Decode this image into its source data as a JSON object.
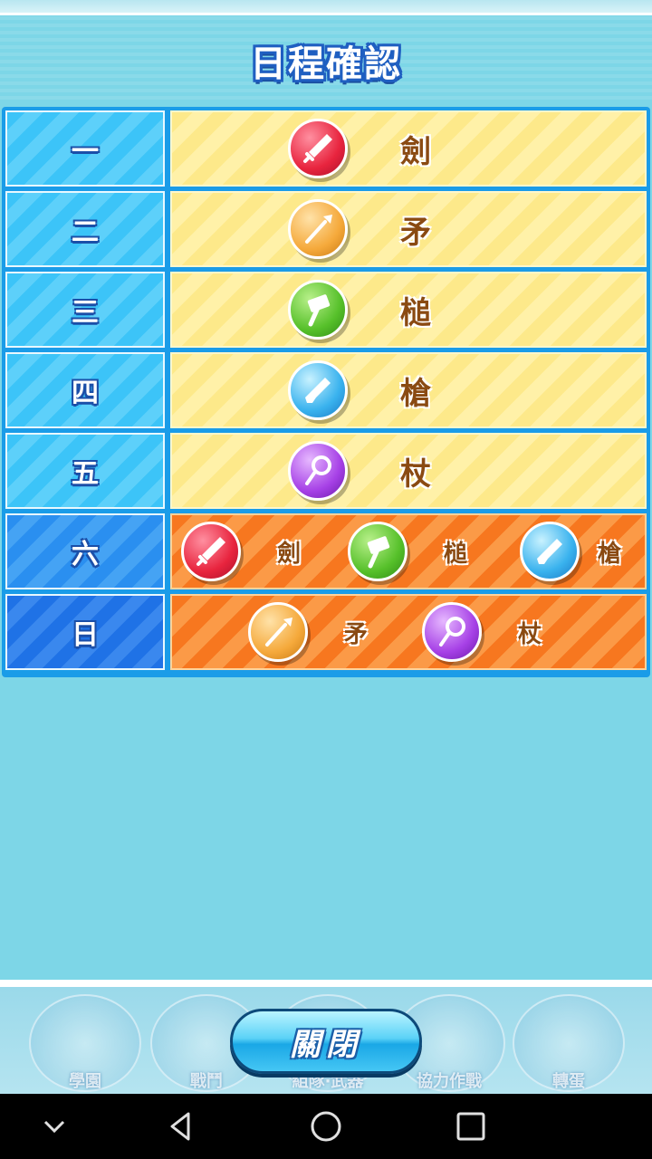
{
  "header": {
    "title": "日程確認"
  },
  "schedule": [
    {
      "day": "一",
      "type": "weekday",
      "weapons": [
        {
          "name": "劍",
          "icon": "sword-icon",
          "color": "#e8243e"
        }
      ]
    },
    {
      "day": "二",
      "type": "weekday",
      "weapons": [
        {
          "name": "矛",
          "icon": "spear-icon",
          "color": "#f5a93b"
        }
      ]
    },
    {
      "day": "三",
      "type": "weekday",
      "weapons": [
        {
          "name": "槌",
          "icon": "hammer-icon",
          "color": "#56c02a"
        }
      ]
    },
    {
      "day": "四",
      "type": "weekday",
      "weapons": [
        {
          "name": "槍",
          "icon": "gun-icon",
          "color": "#39b2ee"
        }
      ]
    },
    {
      "day": "五",
      "type": "weekday",
      "weapons": [
        {
          "name": "杖",
          "icon": "staff-icon",
          "color": "#a640e6"
        }
      ]
    },
    {
      "day": "六",
      "type": "weekend",
      "weapons": [
        {
          "name": "劍",
          "icon": "sword-icon",
          "color": "#e8243e"
        },
        {
          "name": "槌",
          "icon": "hammer-icon",
          "color": "#56c02a"
        },
        {
          "name": "槍",
          "icon": "gun-icon",
          "color": "#39b2ee"
        }
      ]
    },
    {
      "day": "日",
      "type": "sunday",
      "weapons": [
        {
          "name": "矛",
          "icon": "spear-icon",
          "color": "#f5a93b"
        },
        {
          "name": "杖",
          "icon": "staff-icon",
          "color": "#a640e6"
        }
      ]
    }
  ],
  "footer": {
    "close_label": "關閉",
    "nav_items": [
      {
        "label": "學園",
        "icon": "school-icon"
      },
      {
        "label": "戰鬥",
        "icon": "battle-icon"
      },
      {
        "label": "組隊·武器",
        "icon": "team-weapon-icon"
      },
      {
        "label": "協力作戰",
        "icon": "coop-icon"
      },
      {
        "label": "轉蛋",
        "icon": "gacha-icon"
      }
    ]
  },
  "system_nav": [
    "chevron-down-icon",
    "back-icon",
    "home-icon",
    "recents-icon"
  ]
}
